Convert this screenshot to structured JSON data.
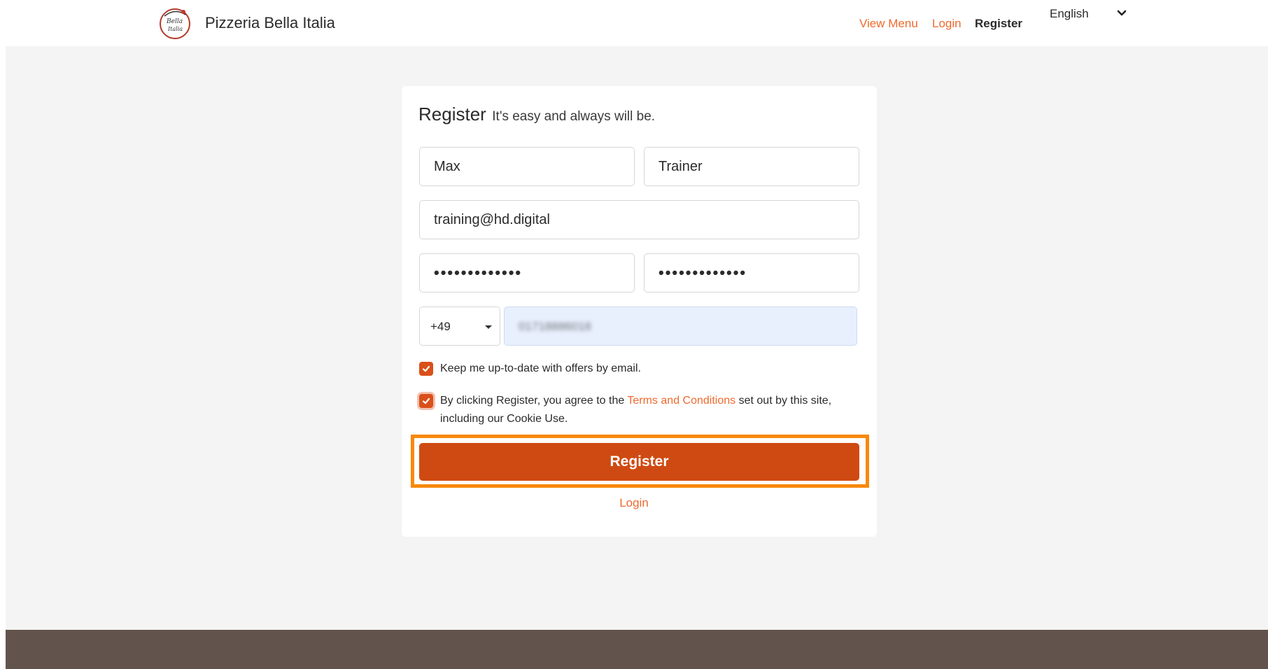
{
  "header": {
    "brand": "Pizzeria Bella Italia",
    "logo_icon": "bella-italia-logo",
    "nav": {
      "view_menu": "View Menu",
      "login": "Login",
      "register": "Register"
    },
    "language": "English"
  },
  "form": {
    "title": "Register",
    "subtitle": "It's easy and always will be.",
    "first_name": "Max",
    "last_name": "Trainer",
    "email": "training@hd.digital",
    "password_mask": "•••••••••••••",
    "password_confirm_mask": "•••••••••••••",
    "country_code": "+49",
    "phone_blurred": "01718886018",
    "newsletter": {
      "checked": true,
      "label": "Keep me up-to-date with offers by email."
    },
    "terms": {
      "checked": true,
      "label_before": "By clicking Register, you agree to the ",
      "link": "Terms and Conditions",
      "label_after": " set out by this site, including our Cookie Use."
    },
    "submit": "Register",
    "login_link": "Login"
  },
  "colors": {
    "accent": "#ef6a2e",
    "button": "#cf4a12",
    "highlight": "#f7890c",
    "footer": "#62544c",
    "background": "#f4f4f4"
  }
}
